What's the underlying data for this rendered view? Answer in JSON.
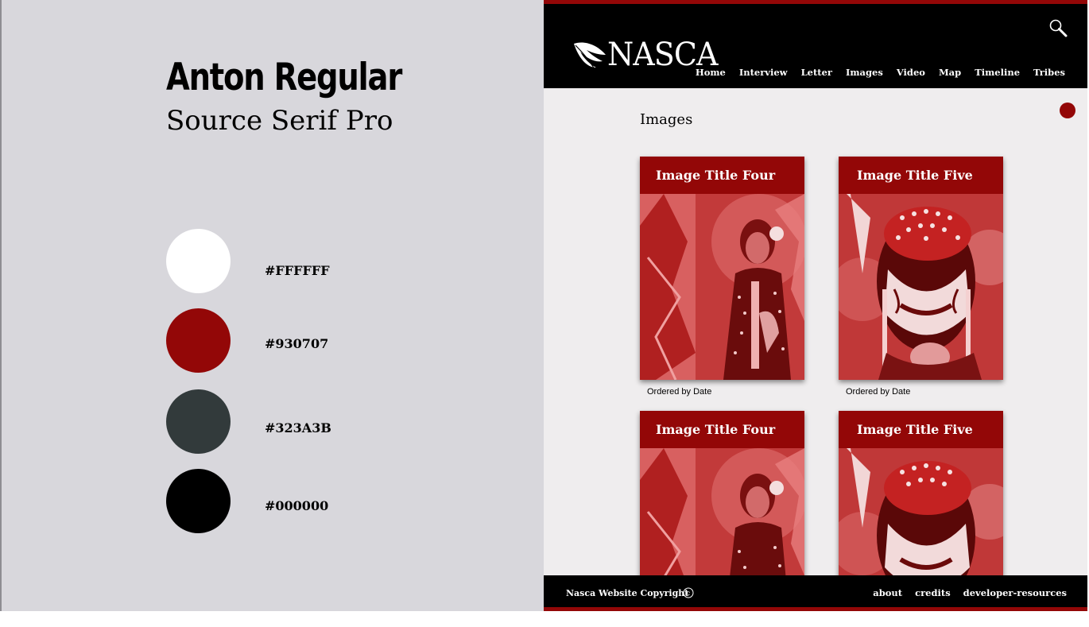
{
  "style_guide": {
    "heading_font_sample": "Anton Regular",
    "body_font_sample": "Source Serif Pro",
    "swatches": [
      {
        "hex": "#FFFFFF",
        "label": "#FFFFFF"
      },
      {
        "hex": "#930707",
        "label": "#930707"
      },
      {
        "hex": "#323A3B",
        "label": "#323A3B"
      },
      {
        "hex": "#000000",
        "label": "#000000"
      }
    ]
  },
  "mockup": {
    "colors": {
      "accent": "#930707",
      "header_bg": "#000000",
      "page_bg": "#efedee"
    },
    "logo_text": "NASCA",
    "logo_icon": "feather-quill-icon",
    "search_icon": "search-icon",
    "nav": [
      "Home",
      "Interview",
      "Letter",
      "Images",
      "Video",
      "Map",
      "Timeline",
      "Tribes"
    ],
    "page_title": "Images",
    "cards": [
      {
        "title": "Image Title Four",
        "caption": "Ordered by Date",
        "photo": "girl-in-regalia-photo"
      },
      {
        "title": "Image Title Five",
        "caption": "Ordered by Date",
        "photo": "painted-face-man-photo"
      },
      {
        "title": "Image Title Four",
        "caption": "",
        "photo": "girl-in-regalia-photo"
      },
      {
        "title": "Image Title Five",
        "caption": "",
        "photo": "painted-face-man-photo"
      }
    ],
    "footer": {
      "copyright": "Nasca Website Copyright",
      "copyright_icon": "copyright-icon",
      "links": [
        "about",
        "credits",
        "developer-resources"
      ]
    }
  }
}
